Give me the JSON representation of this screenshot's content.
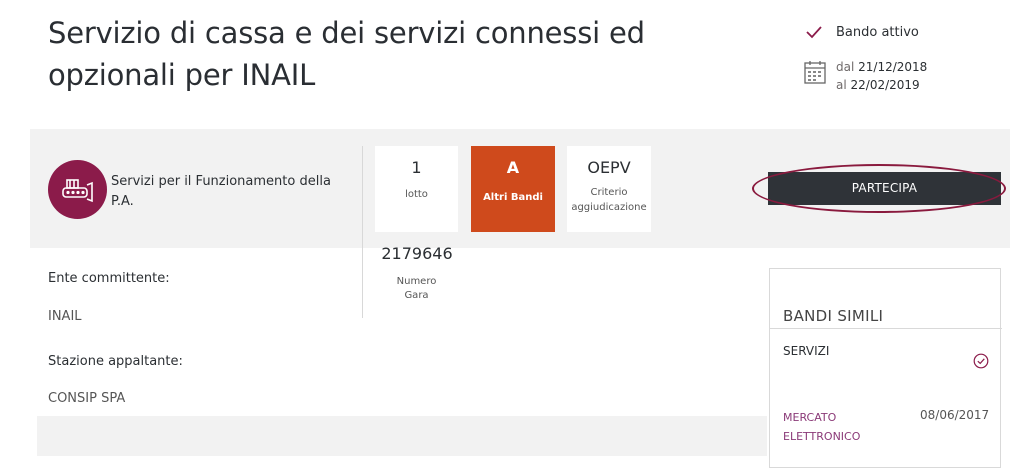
{
  "header": {
    "title": "Servizio di cassa e dei servizi connessi ed opzionali per INAIL",
    "status": "Bando attivo",
    "date_from_prefix": "dal",
    "date_from": "21/12/2018",
    "date_to_prefix": "al",
    "date_to": "22/02/2019"
  },
  "category": {
    "label": "Servizi per il Funzionamento della P.A.",
    "icon": "services-icon",
    "color": "#8b1b4a"
  },
  "tiles": {
    "lotto": {
      "value": "1",
      "label": "lotto"
    },
    "tipo": {
      "value": "A",
      "label": "Altri Bandi",
      "color": "#cf4a1c"
    },
    "criterio": {
      "value": "OEPV",
      "label_line1": "Criterio",
      "label_line2": "aggiudicazione"
    }
  },
  "gara": {
    "value": "2179646",
    "label_line1": "Numero",
    "label_line2": "Gara"
  },
  "cta": {
    "label": "PARTECIPA"
  },
  "info": {
    "ente_label": "Ente committente:",
    "ente_value": "INAIL",
    "stazione_label": "Stazione appaltante:",
    "stazione_value": "CONSIP SPA"
  },
  "similar": {
    "title": "BANDI SIMILI",
    "category": "SERVIZI",
    "link_line1": "MERCATO",
    "link_line2": "ELETTRONICO",
    "date": "08/06/2017",
    "link_color": "#8b3a78"
  }
}
